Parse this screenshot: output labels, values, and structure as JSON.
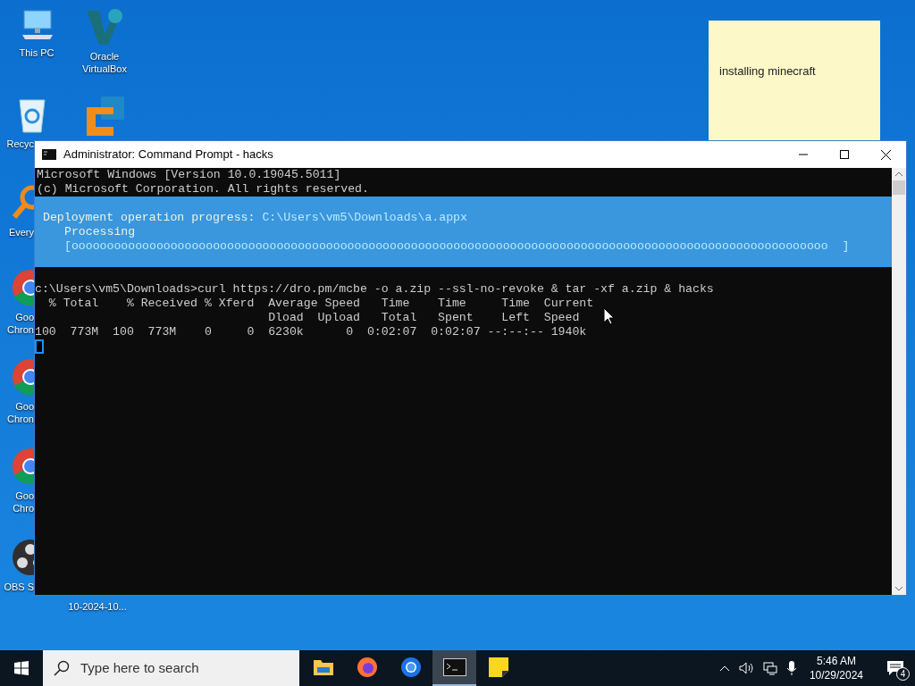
{
  "desktop_icons": [
    {
      "kind": "pc",
      "label": [
        "This PC"
      ]
    },
    {
      "kind": "virtualbox",
      "label": [
        "Oracle",
        "VirtualBox"
      ]
    },
    {
      "kind": "recycle",
      "label": [
        "Recyc"
      ]
    },
    {
      "kind": "orange-app"
    },
    {
      "kind": "everything",
      "label": [
        "Every"
      ]
    },
    {
      "kind": "chrome",
      "label": [
        "Goo",
        "Chron"
      ]
    },
    {
      "kind": "chrome",
      "label": [
        "Goo",
        "Chron"
      ]
    },
    {
      "kind": "chrome",
      "label": [
        "Goo",
        "Chro"
      ]
    },
    {
      "kind": "obs",
      "label": [
        "OBS S"
      ]
    },
    {
      "kind": "file",
      "label": [
        "10-2024-10..."
      ]
    }
  ],
  "sticky_note": {
    "text": "installing minecraft"
  },
  "window": {
    "title": "Administrator: Command Prompt - hacks",
    "header_lines": [
      "Microsoft Windows [Version 10.0.19045.5011]",
      "(c) Microsoft Corporation. All rights reserved."
    ],
    "progress": {
      "label": "Deployment operation progress:",
      "path": "C:\\Users\\vm5\\Downloads\\a.appx",
      "status": "Processing",
      "bar": "[ooooooooooooooooooooooooooooooooooooooooooooooooooooooooooooooooooooooooooooooooooooooooooooooooooooooooooo  ]"
    },
    "output_lines": [
      "c:\\Users\\vm5\\Downloads>curl https://dro.pm/mcbe -o a.zip --ssl-no-revoke & tar -xf a.zip & hacks",
      "  % Total    % Received % Xferd  Average Speed   Time    Time     Time  Current",
      "                                 Dload  Upload   Total   Spent    Left  Speed",
      "100  773M  100  773M    0     0  6230k      0  0:02:07  0:02:07 --:--:-- 1940k"
    ]
  },
  "taskbar": {
    "search_placeholder": "Type here to search",
    "apps": [
      {
        "kind": "explorer",
        "selected": false
      },
      {
        "kind": "firefox",
        "selected": false
      },
      {
        "kind": "chrome",
        "selected": false
      },
      {
        "kind": "terminal",
        "selected": true
      },
      {
        "kind": "notes",
        "selected": false
      }
    ],
    "time": "5:46 AM",
    "date": "10/29/2024",
    "notification_count": "4"
  }
}
